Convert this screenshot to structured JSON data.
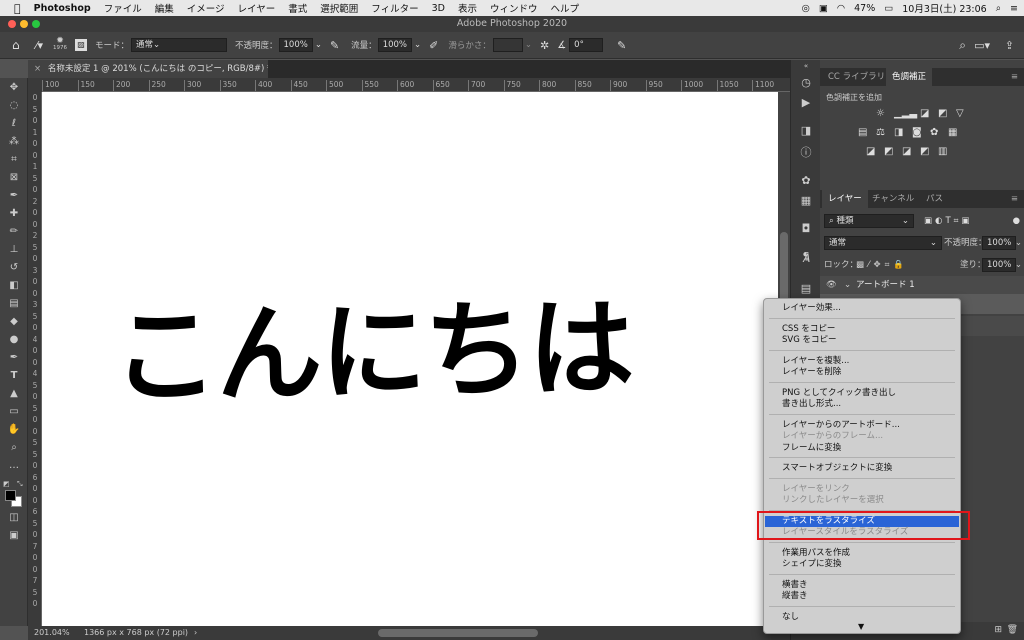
{
  "menubar": {
    "apple": "",
    "app": "Photoshop",
    "items": [
      "ファイル",
      "編集",
      "イメージ",
      "レイヤー",
      "書式",
      "選択範囲",
      "フィルター",
      "3D",
      "表示",
      "ウィンドウ",
      "ヘルプ"
    ],
    "battery": "47%",
    "datetime": "10月3日(土)  23:06"
  },
  "window": {
    "title": "Adobe Photoshop 2020"
  },
  "options": {
    "brush_size": "1976",
    "mode_label": "モード：",
    "mode_value": "通常",
    "opacity_label": "不透明度：",
    "opacity_value": "100%",
    "flow_label": "流量：",
    "flow_value": "100%",
    "smoothing_label": "滑らかさ：",
    "angle_value": "0°"
  },
  "document": {
    "tab_title": "名称未設定 1 @ 201% (こんにちは のコピー, RGB/8#) *",
    "text": "こんにちは"
  },
  "ruler": {
    "h": [
      "100",
      "150",
      "200",
      "250",
      "300",
      "350",
      "400",
      "450",
      "500",
      "550",
      "600",
      "650",
      "700",
      "750",
      "800",
      "850",
      "900",
      "950",
      "1000",
      "1050",
      "1100"
    ],
    "v": [
      "0",
      "5",
      "0",
      "1",
      "0",
      "0",
      "1",
      "5",
      "0",
      "2",
      "0",
      "0",
      "2",
      "5",
      "0",
      "3",
      "0",
      "0",
      "3",
      "5",
      "0",
      "4",
      "0",
      "0",
      "4",
      "5",
      "0",
      "5",
      "0",
      "0",
      "5",
      "5",
      "0",
      "6",
      "0",
      "0",
      "6",
      "5",
      "0",
      "7",
      "0",
      "0",
      "7",
      "5",
      "0"
    ]
  },
  "status": {
    "zoom": "201.04%",
    "size": "1366 px x 768 px (72 ppi)"
  },
  "panels": {
    "tab_cc": "CC ライブラリ",
    "tab_adjust": "色調補正",
    "adjust_add": "色調補正を追加",
    "tab_layers": "レイヤー",
    "tab_channels": "チャンネル",
    "tab_paths": "パス",
    "kind_label": "種類",
    "blend_value": "通常",
    "opacity_label": "不透明度：",
    "opacity_value": "100%",
    "lock_label": "ロック：",
    "fill_label": "塗り：",
    "fill_value": "100%",
    "artboard_name": "アートボード 1"
  },
  "context_menu": {
    "items": [
      {
        "label": "レイヤー効果...",
        "state": "normal"
      },
      {
        "label": "CSS をコピー",
        "state": "normal"
      },
      {
        "label": "SVG をコピー",
        "state": "normal"
      },
      {
        "label": "レイヤーを複製...",
        "state": "normal"
      },
      {
        "label": "レイヤーを削除",
        "state": "normal"
      },
      {
        "label": "PNG としてクイック書き出し",
        "state": "normal"
      },
      {
        "label": "書き出し形式...",
        "state": "normal"
      },
      {
        "label": "レイヤーからのアートボード...",
        "state": "normal"
      },
      {
        "label": "レイヤーからのフレーム...",
        "state": "disabled"
      },
      {
        "label": "フレームに変換",
        "state": "normal"
      },
      {
        "label": "スマートオブジェクトに変換",
        "state": "normal"
      },
      {
        "label": "レイヤーをリンク",
        "state": "disabled"
      },
      {
        "label": "リンクしたレイヤーを選択",
        "state": "disabled"
      },
      {
        "label": "テキストをラスタライズ",
        "state": "selected"
      },
      {
        "label": "レイヤースタイルをラスタライズ",
        "state": "disabled"
      },
      {
        "label": "作業用パスを作成",
        "state": "normal"
      },
      {
        "label": "シェイプに変換",
        "state": "normal"
      },
      {
        "label": "横書き",
        "state": "normal"
      },
      {
        "label": "縦書き",
        "state": "normal"
      },
      {
        "label": "なし",
        "state": "normal"
      }
    ],
    "more_arrow": "▼"
  },
  "colors": {
    "highlight_box": "#e0161a",
    "menu_selection": "#2a64d6"
  }
}
